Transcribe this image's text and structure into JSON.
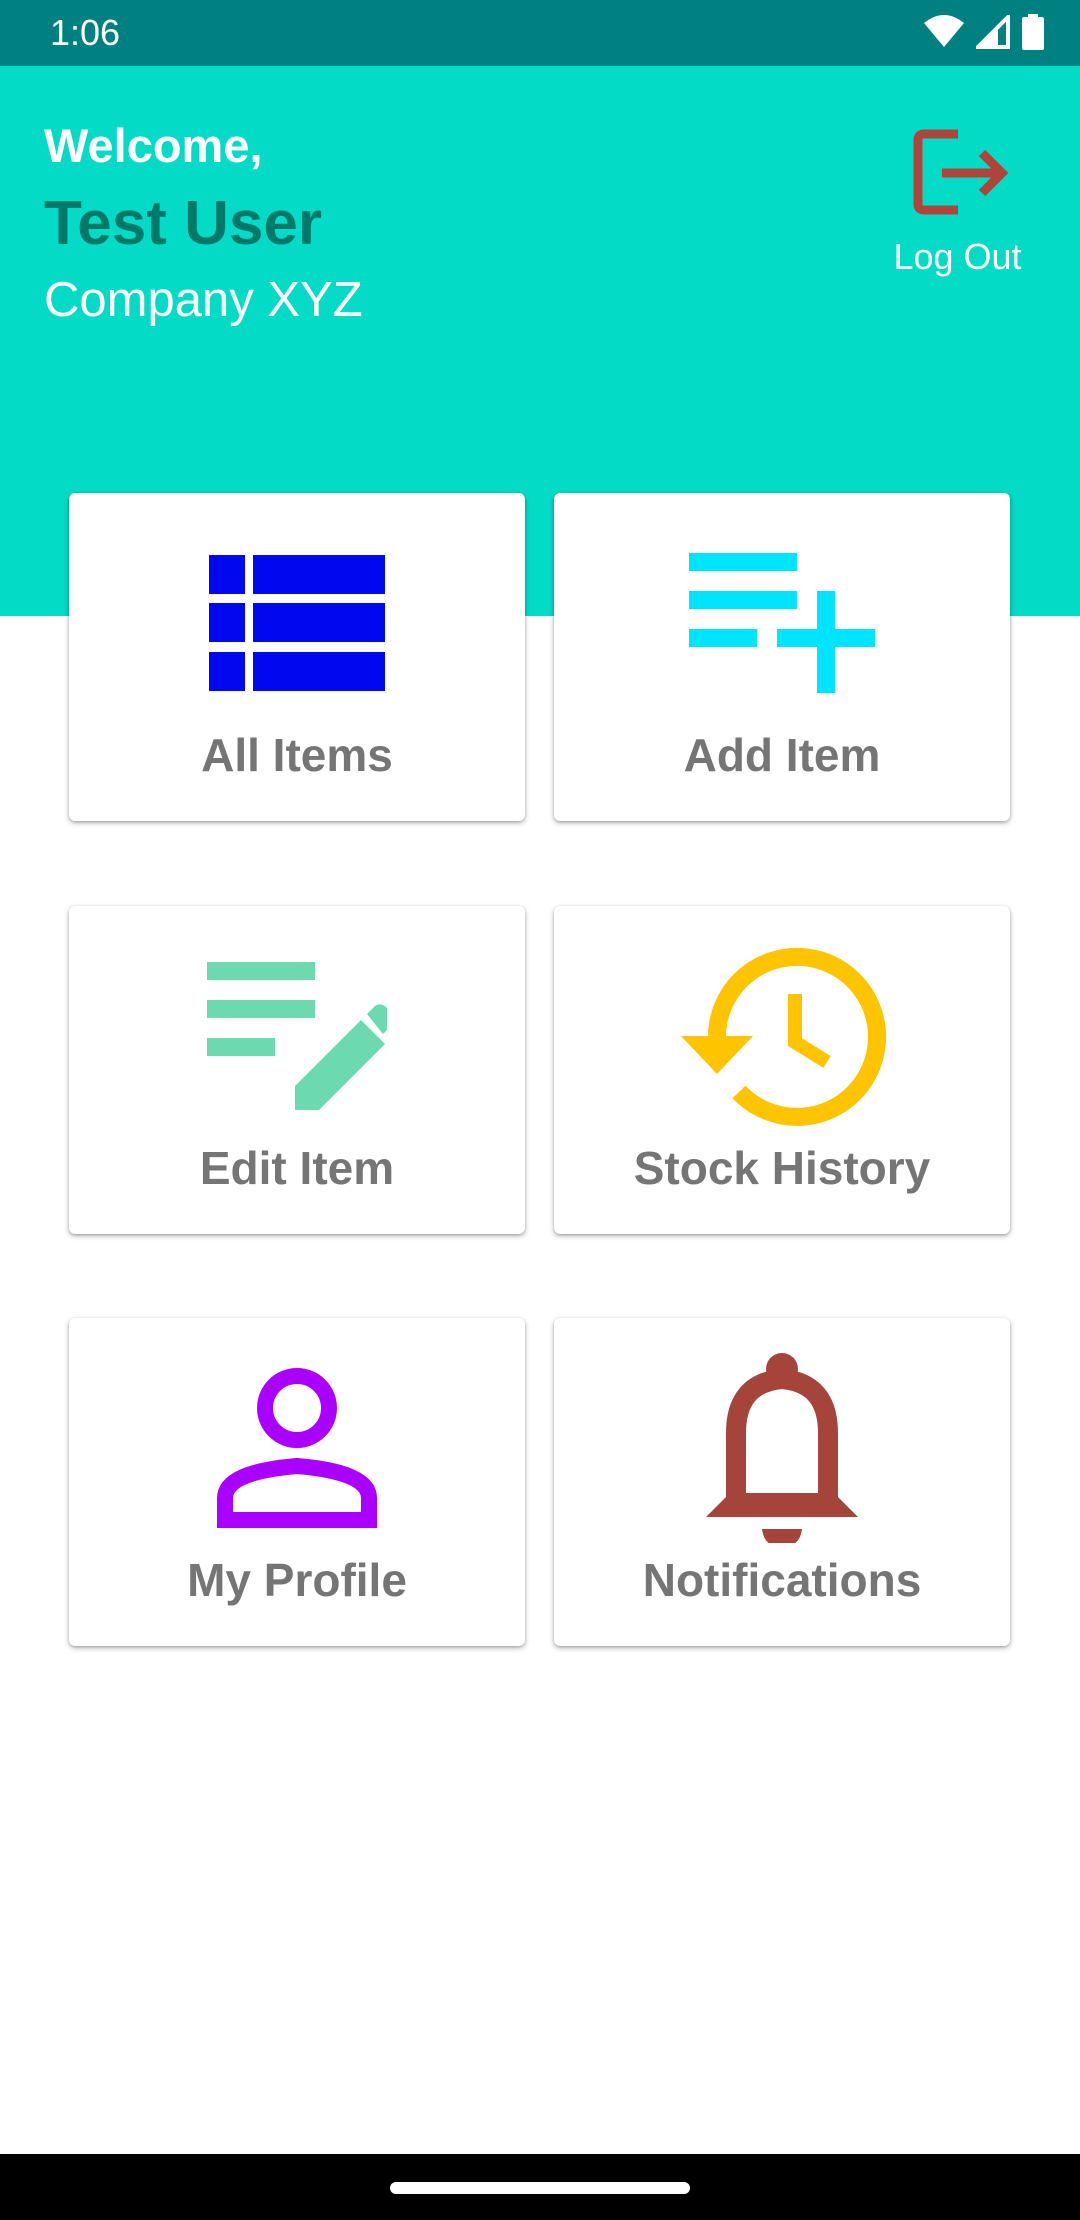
{
  "status_bar": {
    "time": "1:06"
  },
  "header": {
    "welcome": "Welcome,",
    "user_name": "Test User",
    "company": "Company XYZ",
    "logout_label": "Log Out"
  },
  "cards": [
    {
      "label": "All Items",
      "icon": "list-icon",
      "color": "#0008f0"
    },
    {
      "label": "Add Item",
      "icon": "playlist-add-icon",
      "color": "#00e5ff"
    },
    {
      "label": "Edit Item",
      "icon": "edit-note-icon",
      "color": "#6cd9b0"
    },
    {
      "label": "Stock History",
      "icon": "history-icon",
      "color": "#ffc400"
    },
    {
      "label": "My Profile",
      "icon": "person-icon",
      "color": "#aa00ff"
    },
    {
      "label": "Notifications",
      "icon": "bell-icon",
      "color": "#a5443a"
    }
  ],
  "colors": {
    "status_bar": "#008080",
    "header": "#04dbc6",
    "user_name": "#00796b",
    "logout_icon": "#b0443a",
    "card_label": "#757575"
  }
}
